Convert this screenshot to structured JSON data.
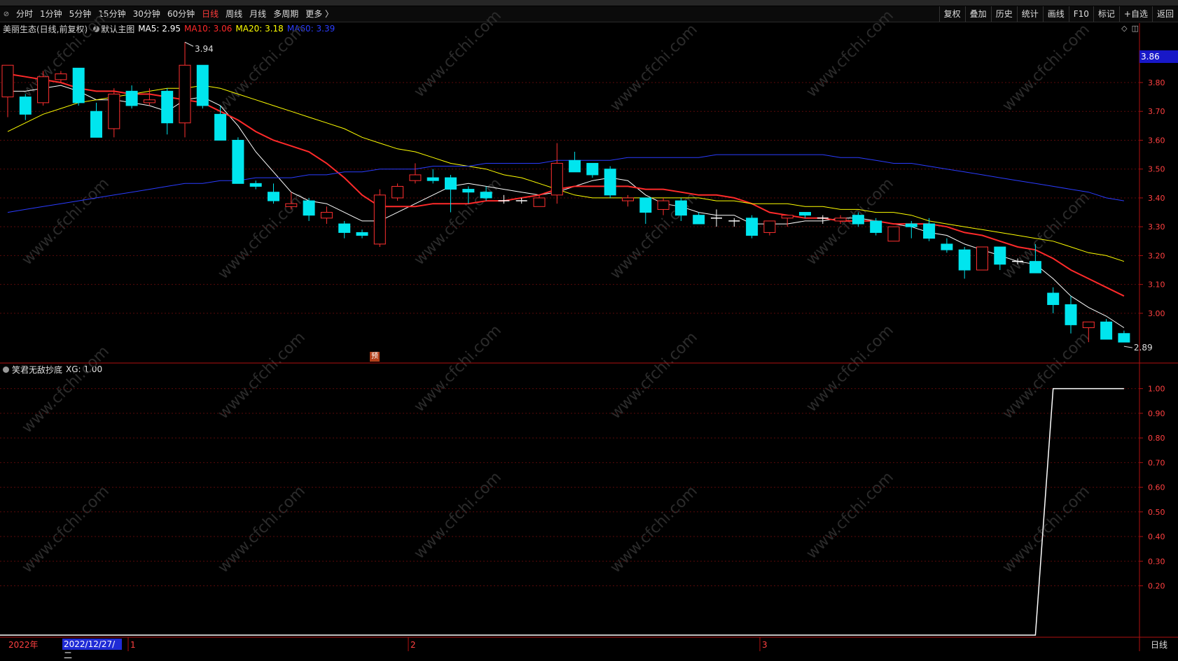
{
  "toolbar": {
    "periods": [
      "分时",
      "1分钟",
      "5分钟",
      "15分钟",
      "30分钟",
      "60分钟",
      "日线",
      "周线",
      "月线",
      "多周期",
      "更多 〉"
    ],
    "active_period": "日线",
    "right_buttons": [
      "复权",
      "叠加",
      "历史",
      "统计",
      "画线",
      "F10",
      "标记",
      "+自选",
      "返回"
    ]
  },
  "main_chart": {
    "stock_title": "美丽生态(日线,前复权)",
    "template": "默认主图",
    "ma": [
      {
        "label": "MA5:",
        "value": "2.95",
        "color": "#ffffff"
      },
      {
        "label": "MA10:",
        "value": "3.06",
        "color": "#ff2a2a"
      },
      {
        "label": "MA20:",
        "value": "3.18",
        "color": "#ffff00"
      },
      {
        "label": "MA60:",
        "value": "3.39",
        "color": "#2a3cff"
      }
    ],
    "high_label": "3.94",
    "low_label": "2.89",
    "current_price": "3.86",
    "y_ticks": [
      "3.80",
      "3.70",
      "3.60",
      "3.50",
      "3.40",
      "3.30",
      "3.20",
      "3.10",
      "3.00"
    ],
    "marker_tag": "预"
  },
  "indicator": {
    "name": "笑君无敌抄底",
    "value_label": "XG: 1.00",
    "y_ticks": [
      "1.00",
      "0.90",
      "0.80",
      "0.70",
      "0.60",
      "0.50",
      "0.40",
      "0.30",
      "0.20"
    ]
  },
  "x_axis": {
    "year_label": "2022年",
    "selected_date": "2022/12/27/二",
    "month_labels": [
      "1",
      "2",
      "3"
    ],
    "period_label": "日线"
  },
  "watermark": "www.cfchi.com",
  "chart_data": {
    "type": "candlestick",
    "series": [
      {
        "open": 3.75,
        "high": 3.82,
        "low": 3.68,
        "close": 3.86
      },
      {
        "open": 3.75,
        "high": 3.76,
        "low": 3.67,
        "close": 3.69
      },
      {
        "open": 3.73,
        "high": 3.84,
        "low": 3.72,
        "close": 3.82
      },
      {
        "open": 3.81,
        "high": 3.84,
        "low": 3.8,
        "close": 3.83
      },
      {
        "open": 3.85,
        "high": 3.85,
        "low": 3.72,
        "close": 3.73
      },
      {
        "open": 3.7,
        "high": 3.73,
        "low": 3.61,
        "close": 3.61
      },
      {
        "open": 3.64,
        "high": 3.78,
        "low": 3.61,
        "close": 3.76
      },
      {
        "open": 3.77,
        "high": 3.79,
        "low": 3.71,
        "close": 3.72
      },
      {
        "open": 3.73,
        "high": 3.78,
        "low": 3.72,
        "close": 3.74
      },
      {
        "open": 3.77,
        "high": 3.78,
        "low": 3.62,
        "close": 3.66
      },
      {
        "open": 3.66,
        "high": 3.94,
        "low": 3.61,
        "close": 3.86
      },
      {
        "open": 3.86,
        "high": 3.86,
        "low": 3.71,
        "close": 3.72
      },
      {
        "open": 3.69,
        "high": 3.72,
        "low": 3.6,
        "close": 3.6
      },
      {
        "open": 3.6,
        "high": 3.61,
        "low": 3.45,
        "close": 3.45
      },
      {
        "open": 3.45,
        "high": 3.46,
        "low": 3.43,
        "close": 3.44
      },
      {
        "open": 3.42,
        "high": 3.45,
        "low": 3.38,
        "close": 3.39
      },
      {
        "open": 3.37,
        "high": 3.42,
        "low": 3.36,
        "close": 3.38
      },
      {
        "open": 3.39,
        "high": 3.4,
        "low": 3.32,
        "close": 3.34
      },
      {
        "open": 3.33,
        "high": 3.37,
        "low": 3.31,
        "close": 3.35
      },
      {
        "open": 3.31,
        "high": 3.32,
        "low": 3.26,
        "close": 3.28
      },
      {
        "open": 3.28,
        "high": 3.29,
        "low": 3.26,
        "close": 3.27
      },
      {
        "open": 3.24,
        "high": 3.43,
        "low": 3.23,
        "close": 3.41
      },
      {
        "open": 3.4,
        "high": 3.45,
        "low": 3.39,
        "close": 3.44
      },
      {
        "open": 3.46,
        "high": 3.52,
        "low": 3.45,
        "close": 3.48
      },
      {
        "open": 3.47,
        "high": 3.5,
        "low": 3.45,
        "close": 3.46
      },
      {
        "open": 3.47,
        "high": 3.48,
        "low": 3.35,
        "close": 3.43
      },
      {
        "open": 3.43,
        "high": 3.44,
        "low": 3.38,
        "close": 3.42
      },
      {
        "open": 3.42,
        "high": 3.44,
        "low": 3.39,
        "close": 3.4
      },
      {
        "open": 3.39,
        "high": 3.41,
        "low": 3.38,
        "close": 3.39
      },
      {
        "open": 3.39,
        "high": 3.4,
        "low": 3.38,
        "close": 3.39
      },
      {
        "open": 3.37,
        "high": 3.41,
        "low": 3.37,
        "close": 3.4
      },
      {
        "open": 3.41,
        "high": 3.59,
        "low": 3.38,
        "close": 3.52
      },
      {
        "open": 3.53,
        "high": 3.56,
        "low": 3.5,
        "close": 3.49
      },
      {
        "open": 3.52,
        "high": 3.52,
        "low": 3.47,
        "close": 3.48
      },
      {
        "open": 3.5,
        "high": 3.51,
        "low": 3.4,
        "close": 3.41
      },
      {
        "open": 3.39,
        "high": 3.41,
        "low": 3.37,
        "close": 3.4
      },
      {
        "open": 3.4,
        "high": 3.4,
        "low": 3.31,
        "close": 3.35
      },
      {
        "open": 3.36,
        "high": 3.4,
        "low": 3.34,
        "close": 3.39
      },
      {
        "open": 3.39,
        "high": 3.4,
        "low": 3.32,
        "close": 3.34
      },
      {
        "open": 3.34,
        "high": 3.35,
        "low": 3.31,
        "close": 3.31
      },
      {
        "open": 3.33,
        "high": 3.36,
        "low": 3.3,
        "close": 3.33
      },
      {
        "open": 3.32,
        "high": 3.33,
        "low": 3.3,
        "close": 3.32
      },
      {
        "open": 3.33,
        "high": 3.34,
        "low": 3.26,
        "close": 3.27
      },
      {
        "open": 3.28,
        "high": 3.32,
        "low": 3.27,
        "close": 3.32
      },
      {
        "open": 3.33,
        "high": 3.34,
        "low": 3.3,
        "close": 3.34
      },
      {
        "open": 3.35,
        "high": 3.35,
        "low": 3.33,
        "close": 3.34
      },
      {
        "open": 3.33,
        "high": 3.34,
        "low": 3.31,
        "close": 3.33
      },
      {
        "open": 3.32,
        "high": 3.34,
        "low": 3.31,
        "close": 3.33
      },
      {
        "open": 3.34,
        "high": 3.35,
        "low": 3.3,
        "close": 3.31
      },
      {
        "open": 3.32,
        "high": 3.33,
        "low": 3.27,
        "close": 3.28
      },
      {
        "open": 3.25,
        "high": 3.3,
        "low": 3.25,
        "close": 3.3
      },
      {
        "open": 3.31,
        "high": 3.32,
        "low": 3.26,
        "close": 3.3
      },
      {
        "open": 3.31,
        "high": 3.33,
        "low": 3.25,
        "close": 3.26
      },
      {
        "open": 3.24,
        "high": 3.26,
        "low": 3.21,
        "close": 3.22
      },
      {
        "open": 3.22,
        "high": 3.23,
        "low": 3.12,
        "close": 3.15
      },
      {
        "open": 3.15,
        "high": 3.23,
        "low": 3.15,
        "close": 3.23
      },
      {
        "open": 3.23,
        "high": 3.23,
        "low": 3.15,
        "close": 3.17
      },
      {
        "open": 3.18,
        "high": 3.19,
        "low": 3.17,
        "close": 3.18
      },
      {
        "open": 3.18,
        "high": 3.24,
        "low": 3.14,
        "close": 3.14
      },
      {
        "open": 3.07,
        "high": 3.09,
        "low": 3.0,
        "close": 3.03
      },
      {
        "open": 3.03,
        "high": 3.06,
        "low": 2.93,
        "close": 2.96
      },
      {
        "open": 2.95,
        "high": 2.97,
        "low": 2.9,
        "close": 2.97
      },
      {
        "open": 2.97,
        "high": 2.98,
        "low": 2.91,
        "close": 2.91
      },
      {
        "open": 2.93,
        "high": 2.94,
        "low": 2.9,
        "close": 2.9
      }
    ],
    "ma_lines": [
      {
        "name": "MA5",
        "color": "#ffffff",
        "values": [
          3.77,
          3.77,
          3.78,
          3.79,
          3.77,
          3.74,
          3.74,
          3.73,
          3.72,
          3.7,
          3.74,
          3.75,
          3.72,
          3.65,
          3.56,
          3.49,
          3.42,
          3.39,
          3.38,
          3.35,
          3.32,
          3.32,
          3.35,
          3.38,
          3.41,
          3.44,
          3.45,
          3.44,
          3.43,
          3.42,
          3.41,
          3.42,
          3.44,
          3.46,
          3.47,
          3.46,
          3.41,
          3.38,
          3.37,
          3.35,
          3.34,
          3.34,
          3.31,
          3.31,
          3.31,
          3.32,
          3.32,
          3.33,
          3.33,
          3.32,
          3.31,
          3.3,
          3.28,
          3.27,
          3.24,
          3.22,
          3.2,
          3.18,
          3.17,
          3.12,
          3.06,
          3.02,
          2.99,
          2.95
        ]
      },
      {
        "name": "MA10",
        "color": "#ff2a2a",
        "values": [
          3.83,
          3.82,
          3.81,
          3.8,
          3.78,
          3.77,
          3.77,
          3.76,
          3.76,
          3.75,
          3.74,
          3.73,
          3.7,
          3.67,
          3.63,
          3.6,
          3.58,
          3.56,
          3.52,
          3.47,
          3.41,
          3.37,
          3.37,
          3.37,
          3.38,
          3.38,
          3.38,
          3.39,
          3.39,
          3.4,
          3.41,
          3.43,
          3.44,
          3.44,
          3.44,
          3.44,
          3.43,
          3.43,
          3.42,
          3.41,
          3.41,
          3.4,
          3.38,
          3.35,
          3.34,
          3.33,
          3.33,
          3.32,
          3.32,
          3.32,
          3.31,
          3.31,
          3.31,
          3.3,
          3.28,
          3.27,
          3.25,
          3.23,
          3.22,
          3.19,
          3.15,
          3.12,
          3.09,
          3.06
        ]
      },
      {
        "name": "MA20",
        "color": "#ffff00",
        "values": [
          3.63,
          3.66,
          3.69,
          3.71,
          3.73,
          3.74,
          3.75,
          3.76,
          3.77,
          3.78,
          3.78,
          3.79,
          3.78,
          3.76,
          3.74,
          3.72,
          3.7,
          3.68,
          3.66,
          3.64,
          3.61,
          3.59,
          3.57,
          3.56,
          3.54,
          3.52,
          3.51,
          3.5,
          3.48,
          3.47,
          3.45,
          3.43,
          3.41,
          3.4,
          3.4,
          3.4,
          3.4,
          3.4,
          3.4,
          3.4,
          3.39,
          3.39,
          3.38,
          3.38,
          3.38,
          3.37,
          3.37,
          3.36,
          3.36,
          3.35,
          3.35,
          3.34,
          3.32,
          3.31,
          3.3,
          3.29,
          3.28,
          3.27,
          3.26,
          3.25,
          3.23,
          3.21,
          3.2,
          3.18
        ]
      },
      {
        "name": "MA60",
        "color": "#2a3cff",
        "values": [
          3.35,
          3.36,
          3.37,
          3.38,
          3.39,
          3.4,
          3.41,
          3.42,
          3.43,
          3.44,
          3.45,
          3.45,
          3.46,
          3.46,
          3.47,
          3.47,
          3.47,
          3.48,
          3.48,
          3.49,
          3.49,
          3.5,
          3.5,
          3.5,
          3.51,
          3.51,
          3.51,
          3.52,
          3.52,
          3.52,
          3.52,
          3.53,
          3.53,
          3.53,
          3.53,
          3.54,
          3.54,
          3.54,
          3.54,
          3.54,
          3.55,
          3.55,
          3.55,
          3.55,
          3.55,
          3.55,
          3.55,
          3.54,
          3.54,
          3.53,
          3.52,
          3.52,
          3.51,
          3.5,
          3.49,
          3.48,
          3.47,
          3.46,
          3.45,
          3.44,
          3.43,
          3.42,
          3.4,
          3.39
        ]
      }
    ],
    "indicator_series": {
      "name": "XG",
      "values": [
        0,
        0,
        0,
        0,
        0,
        0,
        0,
        0,
        0,
        0,
        0,
        0,
        0,
        0,
        0,
        0,
        0,
        0,
        0,
        0,
        0,
        0,
        0,
        0,
        0,
        0,
        0,
        0,
        0,
        0,
        0,
        0,
        0,
        0,
        0,
        0,
        0,
        0,
        0,
        0,
        0,
        0,
        0,
        0,
        0,
        0,
        0,
        0,
        0,
        0,
        0,
        0,
        0,
        0,
        0,
        0,
        0,
        0,
        0,
        1,
        1,
        1,
        1,
        1
      ]
    },
    "ylim_price": [
      2.83,
      3.96
    ],
    "ylim_indicator": [
      0,
      1.05
    ]
  }
}
